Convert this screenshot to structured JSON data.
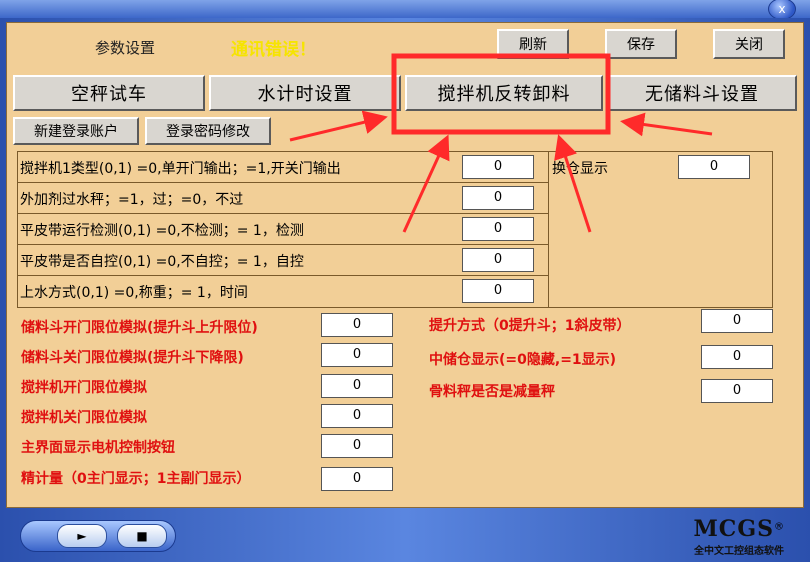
{
  "window": {
    "close_glyph": "x"
  },
  "header": {
    "title": "参数设置",
    "comm_error": "通讯错误！",
    "refresh_label": "刷新",
    "save_label": "保存",
    "close_label": "关闭"
  },
  "tabs": [
    {
      "label": "空秤试车"
    },
    {
      "label": "水计时设置"
    },
    {
      "label": "搅拌机反转卸料"
    },
    {
      "label": "无储料斗设置"
    }
  ],
  "account": {
    "new_account_label": "新建登录账户",
    "change_password_label": "登录密码修改"
  },
  "grid_rows": [
    {
      "label": "搅拌机1类型(0,1)  =0,单开门输出；=1,开关门输出",
      "value": "0"
    },
    {
      "label": "外加剂过水秤；=1，过；=0，不过",
      "value": "0"
    },
    {
      "label": "平皮带运行检测(0,1)  =0,不检测；= 1，检测",
      "value": "0"
    },
    {
      "label": "平皮带是否自控(0,1)  =0,不自控；= 1，自控",
      "value": "0"
    },
    {
      "label": "上水方式(0,1)  =0,称重；= 1，时间",
      "value": "0"
    }
  ],
  "side_field": {
    "label": "换仓显示",
    "value": "0"
  },
  "left_fields": [
    {
      "label": "储料斗开门限位模拟(提升斗上升限位)",
      "value": "0"
    },
    {
      "label": "储料斗关门限位模拟(提升斗下降限)",
      "value": "0"
    },
    {
      "label": "搅拌机开门限位模拟",
      "value": "0"
    },
    {
      "label": "搅拌机关门限位模拟",
      "value": "0"
    },
    {
      "label": "主界面显示电机控制按钮",
      "value": "0"
    },
    {
      "label": "精计量（0主门显示；1主副门显示）",
      "value": "0"
    }
  ],
  "right_fields": [
    {
      "label": "提升方式（0提升斗；1斜皮带）",
      "value": "0"
    },
    {
      "label": "中储仓显示(=0隐藏,=1显示)",
      "value": "0"
    },
    {
      "label": "骨料秤是否是减量秤",
      "value": "0"
    }
  ],
  "footer": {
    "play_glyph": "►",
    "stop_glyph": "■",
    "brand": "MCGS",
    "brand_mark": "®",
    "brand_sub": "全中文工控组态软件"
  },
  "colors": {
    "accent_red": "#e01010",
    "comm_error": "#f6e400",
    "panel_bg": "#f2cf97",
    "frame_blue": "#3a5fb8",
    "highlight": "#ff2a2a"
  }
}
